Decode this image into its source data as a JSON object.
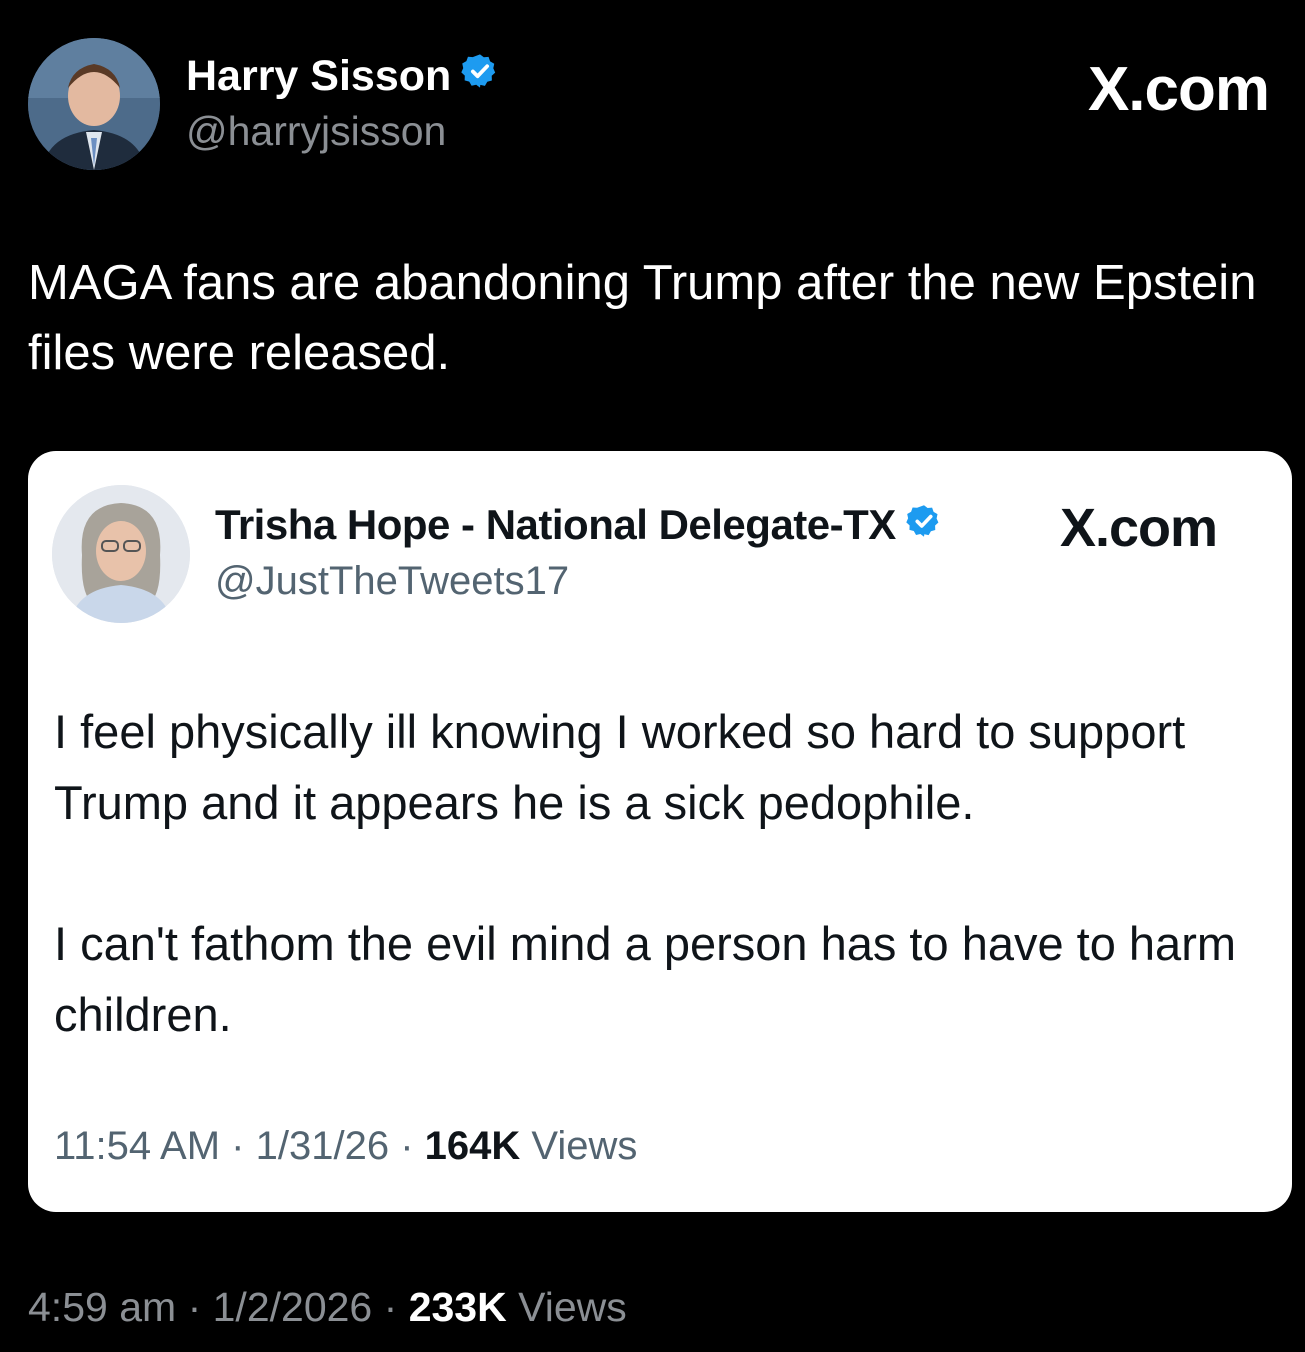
{
  "outer_post": {
    "author_name": "Harry Sisson",
    "handle": "@harryjsisson",
    "watermark": "X.com",
    "text": "MAGA fans are abandoning Trump after the new Epstein files were released.",
    "time": "4:59 am",
    "date": "1/2/2026",
    "views_count": "233K",
    "views_label": "Views",
    "separator": "·",
    "verified_badge_icon": "verified-badge-icon",
    "accent_color": "#1d9bf0"
  },
  "quoted_post": {
    "author_name": "Trisha Hope - National Delegate-TX",
    "handle": "@JustTheTweets17",
    "watermark": "X.com",
    "paragraphs": [
      "I feel physically ill knowing I worked so hard to support Trump and it appears he is a sick pedophile.",
      "I can't fathom the evil mind a person has to have to harm children."
    ],
    "time": "11:54 AM",
    "date": "1/31/26",
    "views_count": "164K",
    "views_label": "Views",
    "separator": "·",
    "verified_badge_icon": "verified-badge-icon",
    "background": "#ffffff"
  }
}
